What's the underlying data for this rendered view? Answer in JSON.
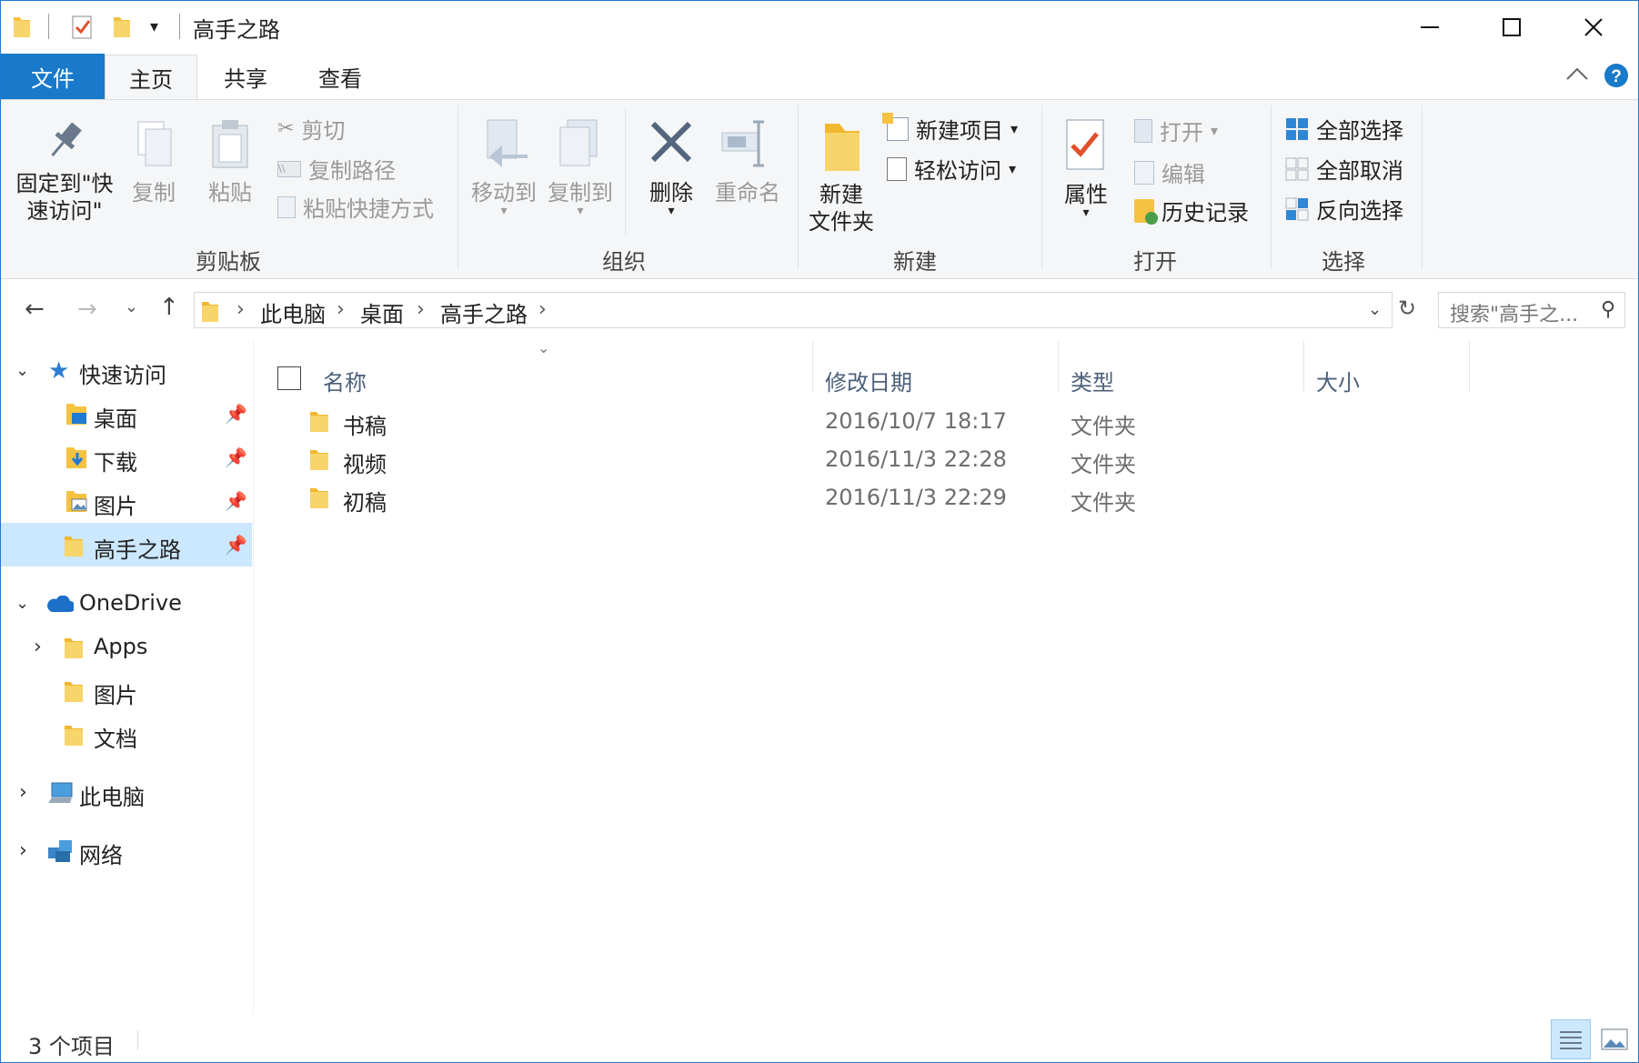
{
  "title": "高手之路",
  "tabs": {
    "file": "文件",
    "home": "主页",
    "share": "共享",
    "view": "查看"
  },
  "ribbon": {
    "pin": "固定到\"快速访问\"",
    "copy": "复制",
    "paste": "粘贴",
    "cut": "剪切",
    "copy_path": "复制路径",
    "paste_shortcut": "粘贴快捷方式",
    "group_clipboard": "剪贴板",
    "move_to": "移动到",
    "copy_to": "复制到",
    "delete": "删除",
    "rename": "重命名",
    "group_organize": "组织",
    "new_folder": "新建\n文件夹",
    "new_item": "新建项目",
    "easy_access": "轻松访问",
    "group_new": "新建",
    "properties": "属性",
    "open": "打开",
    "edit": "编辑",
    "history": "历史记录",
    "group_open": "打开",
    "select_all": "全部选择",
    "select_none": "全部取消",
    "invert_selection": "反向选择",
    "group_select": "选择"
  },
  "address": {
    "crumbs": [
      "此电脑",
      "桌面",
      "高手之路"
    ],
    "search_placeholder": "搜索\"高手之..."
  },
  "nav": {
    "quick_access": "快速访问",
    "quick_items": [
      "桌面",
      "下载",
      "图片",
      "高手之路"
    ],
    "onedrive": "OneDrive",
    "onedrive_items": [
      "Apps",
      "图片",
      "文档"
    ],
    "this_pc": "此电脑",
    "network": "网络"
  },
  "columns": {
    "name": "名称",
    "modified": "修改日期",
    "type": "类型",
    "size": "大小"
  },
  "files": [
    {
      "name": "书稿",
      "modified": "2016/10/7 18:17",
      "type": "文件夹",
      "size": ""
    },
    {
      "name": "视频",
      "modified": "2016/11/3 22:28",
      "type": "文件夹",
      "size": ""
    },
    {
      "name": "初稿",
      "modified": "2016/11/3 22:29",
      "type": "文件夹",
      "size": ""
    }
  ],
  "status": {
    "count": "3 个项目"
  },
  "colors": {
    "accent": "#1979ca",
    "folder": "#f5c242",
    "selected": "#cce8ff"
  }
}
